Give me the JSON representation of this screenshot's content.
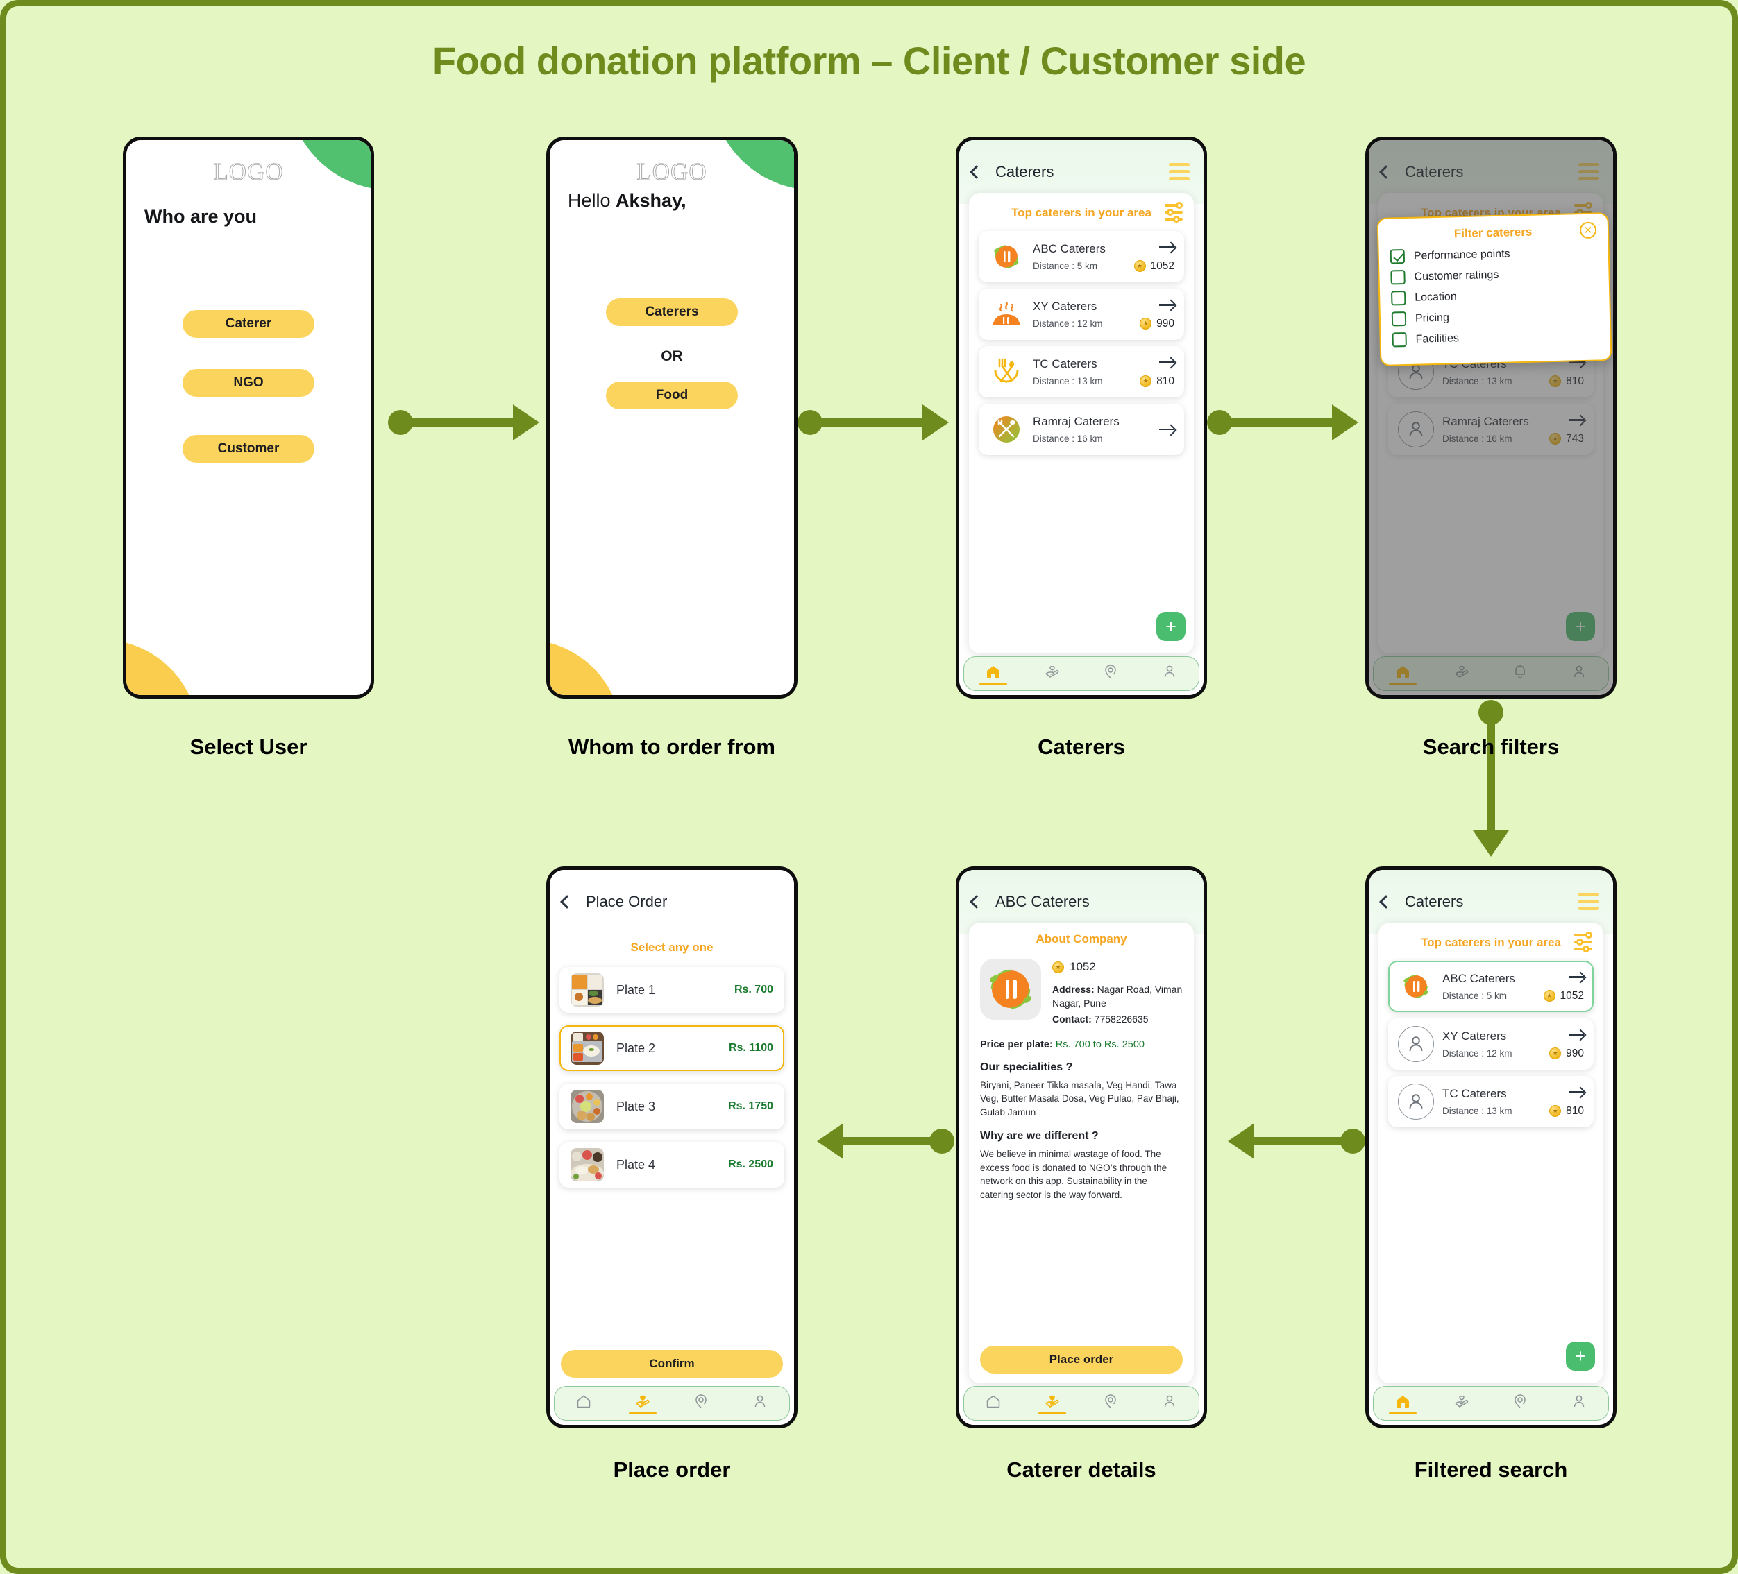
{
  "page": {
    "title": "Food donation platform  – Client / Customer side",
    "bg_color": "#e4f7c3",
    "border_color": "#6e8b1d",
    "accent_yellow": "#fbd45e",
    "accent_orange": "#f5a623",
    "accent_green": "#4bbd6e",
    "price_green": "#1a7a2e"
  },
  "captions": {
    "select_user": "Select User",
    "whom_to_order": "Whom to order from",
    "caterers": "Caterers",
    "search_filters": "Search filters",
    "place_order": "Place order",
    "caterer_details": "Caterer details",
    "filtered_search": "Filtered search"
  },
  "screen_select_user": {
    "logo": "LOGO",
    "heading": "Who are you",
    "buttons": [
      "Caterer",
      "NGO",
      "Customer"
    ]
  },
  "screen_whom_to_order": {
    "logo": "LOGO",
    "greeting_prefix": "Hello ",
    "greeting_name": "Akshay,",
    "button_primary": "Caterers",
    "separator": "OR",
    "button_secondary": "Food"
  },
  "screen_caterers": {
    "header_title": "Caterers",
    "list_heading": "Top caterers in your area",
    "rows": [
      {
        "name": "ABC Caterers",
        "distance": "Distance : 5 km",
        "points": "1052",
        "icon": "plate-cutlery-icon"
      },
      {
        "name": "XY Caterers",
        "distance": "Distance : 12 km",
        "points": "990",
        "icon": "cloche-icon"
      },
      {
        "name": "TC Caterers",
        "distance": "Distance : 13 km",
        "points": "810",
        "icon": "fork-spoon-icon"
      },
      {
        "name": "Ramraj Caterers",
        "distance": "Distance : 16 km",
        "points": "",
        "icon": "crossed-cutlery-icon"
      }
    ],
    "fab": "+",
    "nav": [
      "home-icon",
      "hand-heart-icon",
      "location-pin-icon",
      "person-icon"
    ],
    "nav_active_index": 0
  },
  "screen_search_filters": {
    "header_title": "Caterers",
    "list_heading": "Top caterers in your area",
    "dialog_title": "Filter caterers",
    "close_icon": "close-circle-icon",
    "options": [
      {
        "label": "Performance points",
        "checked": true
      },
      {
        "label": "Customer ratings",
        "checked": false
      },
      {
        "label": "Location",
        "checked": false
      },
      {
        "label": "Pricing",
        "checked": false
      },
      {
        "label": "Facilities",
        "checked": false
      }
    ],
    "rows": [
      {
        "name": "TC Caterers",
        "distance": "Distance : 13 km",
        "points": "810"
      },
      {
        "name": "Ramraj Caterers",
        "distance": "Distance : 16 km",
        "points": "743"
      }
    ],
    "fab": "+",
    "nav": [
      "home-icon",
      "hand-heart-icon",
      "bell-icon",
      "person-icon"
    ],
    "nav_active_index": 0
  },
  "screen_place_order": {
    "header_title": "Place Order",
    "hint": "Select any one",
    "plates": [
      {
        "name": "Plate 1",
        "price": "Rs. 700",
        "selected": false
      },
      {
        "name": "Plate 2",
        "price": "Rs. 1100",
        "selected": true
      },
      {
        "name": "Plate 3",
        "price": "Rs. 1750",
        "selected": false
      },
      {
        "name": "Plate 4",
        "price": "Rs. 2500",
        "selected": false
      }
    ],
    "confirm_label": "Confirm",
    "nav": [
      "home-icon",
      "hand-heart-icon",
      "location-pin-icon",
      "person-icon"
    ],
    "nav_active_index": 1
  },
  "screen_caterer_details": {
    "header_title": "ABC Caterers",
    "about_title": "About Company",
    "points": "1052",
    "address_label": "Address:",
    "address_value": " Nagar Road, Viman Nagar, Pune",
    "contact_label": "Contact:",
    "contact_value": " 7758226635",
    "price_label": "Price per plate:",
    "price_value": " Rs. 700 to Rs. 2500",
    "specialities_heading": "Our specialities ?",
    "specialities_text": "Biryani, Paneer Tikka masala, Veg Handi, Tawa Veg, Butter Masala Dosa, Veg Pulao, Pav Bhaji, Gulab Jamun",
    "different_heading": "Why are we different ?",
    "different_text": "We believe in minimal wastage of food. The excess food is donated to NGO’s through the network on this app. Sustainability in the catering sector is the way forward.",
    "cta_label": "Place order",
    "nav": [
      "home-icon",
      "hand-heart-icon",
      "location-pin-icon",
      "person-icon"
    ],
    "nav_active_index": 1
  },
  "screen_filtered_search": {
    "header_title": "Caterers",
    "list_heading": "Top caterers in your area",
    "rows": [
      {
        "name": "ABC Caterers",
        "distance": "Distance : 5 km",
        "points": "1052",
        "highlight": true
      },
      {
        "name": "XY Caterers",
        "distance": "Distance : 12 km",
        "points": "990",
        "highlight": false
      },
      {
        "name": "TC Caterers",
        "distance": "Distance : 13 km",
        "points": "810",
        "highlight": false
      }
    ],
    "fab": "+",
    "nav": [
      "home-icon",
      "hand-heart-icon",
      "location-pin-icon",
      "person-icon"
    ],
    "nav_active_index": 0
  }
}
